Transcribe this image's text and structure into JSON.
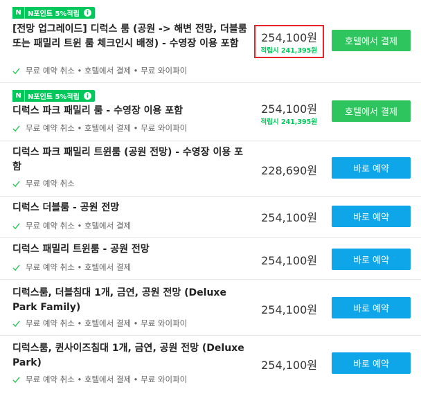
{
  "badge": {
    "logo": "N",
    "text": "N포인트 5%적립",
    "info": "i"
  },
  "rooms": [
    {
      "name": "[전망 업그레이드] 디럭스 룸 (공원 -> 해변 전망, 더블룸 또는 패밀리 트윈 룸 체크인시 배정) - 수영장 이용 포함",
      "conditions": "무료 예약 취소 • 호텔에서 결제 • 무료 와이파이",
      "price": "254,100원",
      "points": "적립시 241,395원",
      "button": "호텔에서 결제"
    },
    {
      "name": "디럭스 파크 패밀리 룸 - 수영장 이용 포함",
      "conditions": "무료 예약 취소 • 호텔에서 결제 • 무료 와이파이",
      "price": "254,100원",
      "points": "적립시 241,395원",
      "button": "호텔에서 결제"
    },
    {
      "name": "디럭스 파크 패밀리 트윈룸 (공원 전망) - 수영장 이용 포함",
      "conditions": "무료 예약 취소",
      "price": "228,690원",
      "button": "바로 예약"
    },
    {
      "name": "디럭스 더블룸 - 공원 전망",
      "conditions": "무료 예약 취소 • 호텔에서 결제",
      "price": "254,100원",
      "button": "바로 예약"
    },
    {
      "name": "디럭스 패밀리 트윈룸 - 공원 전망",
      "conditions": "무료 예약 취소 • 호텔에서 결제",
      "price": "254,100원",
      "button": "바로 예약"
    },
    {
      "name": "디럭스룸, 더블침대 1개, 금연, 공원 전망 (Deluxe Park Family)",
      "conditions": "무료 예약 취소 • 호텔에서 결제 • 무료 와이파이",
      "price": "254,100원",
      "button": "바로 예약"
    },
    {
      "name": "디럭스룸, 퀸사이즈침대 1개, 금연, 공원 전망 (Deluxe Park)",
      "conditions": "무료 예약 취소 • 호텔에서 결제 • 무료 와이파이",
      "price": "254,100원",
      "button": "바로 예약"
    }
  ],
  "colors": {
    "green_button": "#2fc55e",
    "blue_button": "#0ea5e9",
    "points_green": "#03c75a",
    "highlight_red": "#e52527"
  },
  "icons": {
    "check": "check-icon",
    "naver": "naver-n-icon",
    "info": "info-icon"
  }
}
